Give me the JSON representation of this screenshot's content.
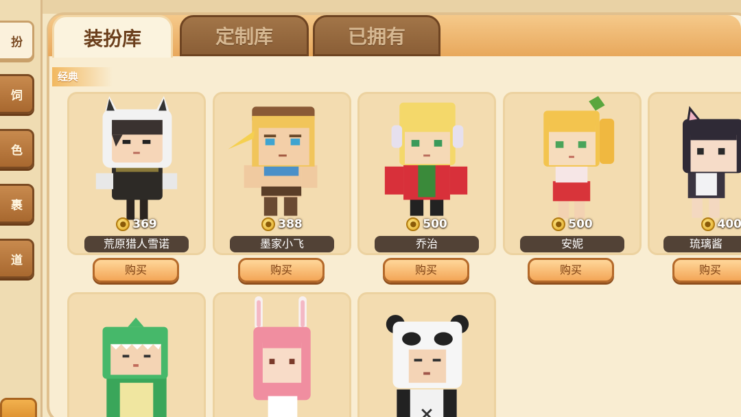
{
  "sidebar": {
    "items": [
      {
        "label": "扮"
      },
      {
        "label": "饲"
      },
      {
        "label": "色"
      },
      {
        "label": "裹"
      },
      {
        "label": "道"
      }
    ]
  },
  "tabs": [
    {
      "label": "装扮库"
    },
    {
      "label": "定制库"
    },
    {
      "label": "已拥有"
    }
  ],
  "section": {
    "label": "经典"
  },
  "cards": [
    {
      "price": "369",
      "name": "荒原猎人雪诺",
      "buy": "购买"
    },
    {
      "price": "388",
      "name": "墨家小飞",
      "buy": "购买"
    },
    {
      "price": "500",
      "name": "乔治",
      "buy": "购买"
    },
    {
      "price": "500",
      "name": "安妮",
      "buy": "购买"
    },
    {
      "price": "400",
      "name": "琉璃酱",
      "buy": "购买"
    }
  ],
  "colors": {
    "panel": "#f9edd2",
    "tab_active": "#fbf3de",
    "tab_inactive": "#8a5e36",
    "button": "#f3a657",
    "name_bar": "#524236"
  }
}
